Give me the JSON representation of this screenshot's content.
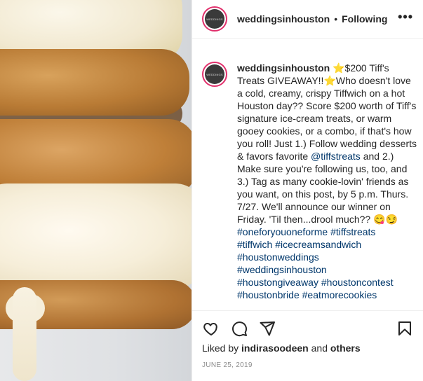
{
  "header": {
    "username": "weddingsinhouston",
    "separator": "•",
    "follow_status": "Following",
    "more_label": "•••"
  },
  "avatar": {
    "text": "WEDDINGS"
  },
  "caption": {
    "username": "weddingsinhouston",
    "star1": "⭐",
    "text1": "$200 Tiff's Treats GIVEAWAY!!",
    "star2": "⭐",
    "text2": "Who doesn't love a cold, creamy, crispy Tiffwich on a hot Houston day?? Score $200 worth of Tiff's signature ice-cream treats, or warm gooey cookies, or a combo, if that's how you roll! Just 1.) Follow wedding desserts & favors favorite ",
    "mention": "@tiffstreats",
    "text3": " and 2.) Make sure you're following us, too, and 3.) Tag as many cookie-lovin' friends as you want, on this post, by 5 p.m. Thurs. 7/27. We'll announce our winner on Friday. 'Til then...drool much?? ",
    "emojis": "😋😏",
    "hashtags": [
      "#oneforyouoneforme",
      "#tiffstreats",
      "#tiffwich",
      "#icecreamsandwich",
      "#houstonweddings",
      "#weddingsinhouston",
      "#houstongiveaway",
      "#houstoncontest",
      "#houstonbride",
      "#eatmorecookies"
    ]
  },
  "likes": {
    "prefix": "Liked by ",
    "user": "indirasoodeen",
    "middle": " and ",
    "others": "others"
  },
  "date": "JUNE 25, 2019",
  "icons": [
    "heart-icon",
    "comment-icon",
    "share-icon",
    "bookmark-icon",
    "more-icon"
  ]
}
